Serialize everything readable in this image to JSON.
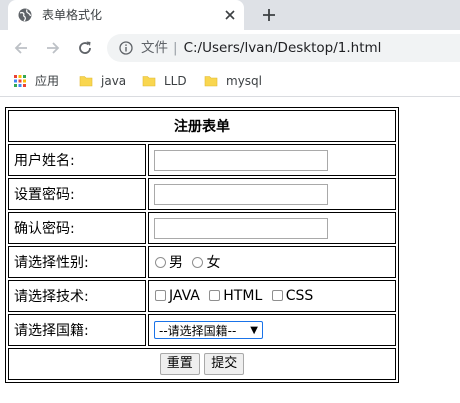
{
  "browser": {
    "tab": {
      "title": "表单格式化"
    },
    "address": {
      "scheme_label": "文件",
      "url": "C:/Users/lvan/Desktop/1.html"
    },
    "bookmarks": [
      {
        "label": "应用",
        "icon": "apps-grid-icon"
      },
      {
        "label": "java",
        "icon": "folder-icon"
      },
      {
        "label": "LLD",
        "icon": "folder-icon"
      },
      {
        "label": "mysql",
        "icon": "folder-icon"
      }
    ]
  },
  "form": {
    "caption": "注册表单",
    "username": {
      "label": "用户姓名:",
      "value": ""
    },
    "password": {
      "label": "设置密码:",
      "value": ""
    },
    "confirm": {
      "label": "确认密码:",
      "value": ""
    },
    "gender": {
      "label": "请选择性别:",
      "options": [
        "男",
        "女"
      ]
    },
    "tech": {
      "label": "请选择技术:",
      "options": [
        "JAVA",
        "HTML",
        "CSS"
      ]
    },
    "nationality": {
      "label": "请选择国籍:",
      "selected": "--请选择国籍--"
    },
    "buttons": {
      "reset": "重置",
      "submit": "提交"
    }
  }
}
